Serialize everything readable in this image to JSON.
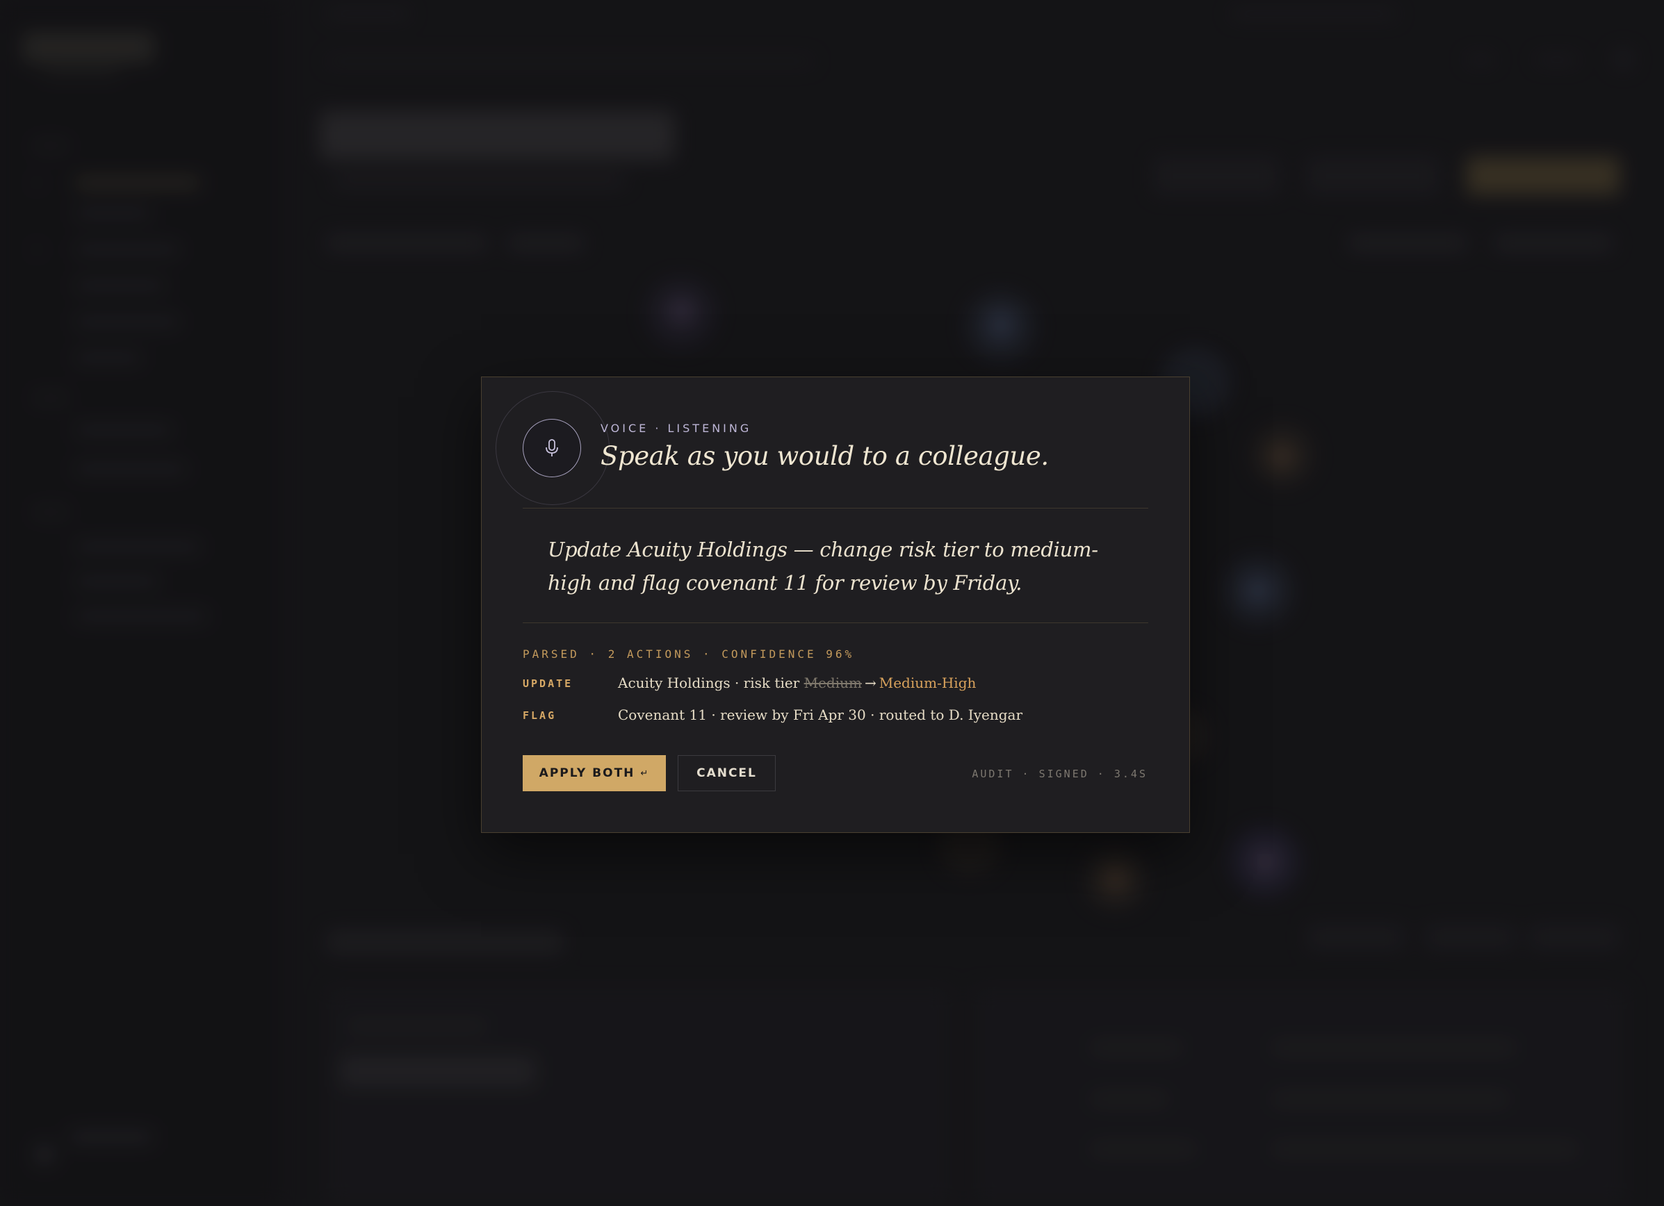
{
  "voice_modal": {
    "eyebrow": "VOICE · LISTENING",
    "headline": "Speak as you would to a colleague.",
    "transcript": "Update Acuity Holdings — change risk tier to medium-high and flag covenant 11 for review by Friday.",
    "parsed_summary": "PARSED · 2 ACTIONS · CONFIDENCE 96%",
    "actions": [
      {
        "verb": "UPDATE",
        "prefix": "Acuity Holdings · risk tier",
        "old_value": "Medium",
        "arrow": "→",
        "new_value": "Medium-High"
      },
      {
        "verb": "FLAG",
        "description": "Covenant 11 · review by Fri Apr 30 · routed to D. Iyengar"
      }
    ],
    "apply_label": "APPLY BOTH",
    "apply_hint": "↵",
    "cancel_label": "CANCEL",
    "audit_text": "AUDIT · SIGNED · 3.4S"
  },
  "icons": {
    "mic": "microphone-icon"
  },
  "colors": {
    "accent_gold": "#d0a866",
    "mic_lavender": "#a6a0bd",
    "modal_bg": "#1f1e21",
    "page_bg": "#19181b"
  }
}
